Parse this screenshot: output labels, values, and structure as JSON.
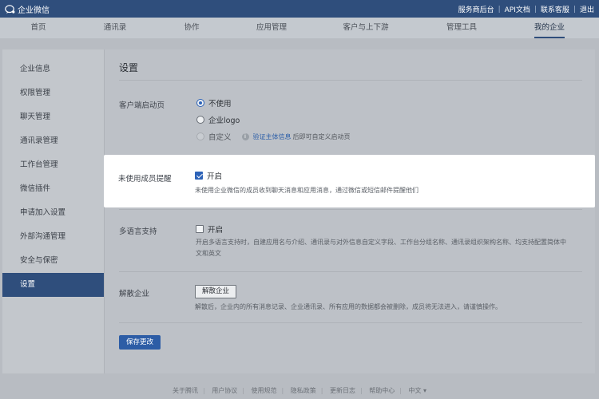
{
  "topbar": {
    "app_name": "企业微信",
    "links": [
      "服务商后台",
      "API文档",
      "联系客服",
      "退出"
    ]
  },
  "nav": {
    "tabs": [
      "首页",
      "通讯录",
      "协作",
      "应用管理",
      "客户与上下游",
      "管理工具",
      "我的企业"
    ],
    "active": "我的企业"
  },
  "sidebar": {
    "items": [
      "企业信息",
      "权限管理",
      "聊天管理",
      "通讯录管理",
      "工作台管理",
      "微信插件",
      "申请加入设置",
      "外部沟通管理",
      "安全与保密",
      "设置"
    ],
    "active": "设置"
  },
  "settings": {
    "title": "设置",
    "startup": {
      "label": "客户端启动页",
      "options": [
        "不使用",
        "企业logo",
        "自定义"
      ],
      "selected": "不使用",
      "custom_link": "验证主体信息",
      "custom_hint": "后即可自定义启动页"
    },
    "unused_reminder": {
      "label": "未使用成员提醒",
      "checkbox_label": "开启",
      "checked": true,
      "hint": "未使用企业微信的成员收到聊天消息和应用消息，通过微信或短信邮件提醒他们"
    },
    "multilang": {
      "label": "多语言支持",
      "checkbox_label": "开启",
      "checked": false,
      "hint_line1": "开启多语言支持时，自建应用名与介绍、通讯录与对外信息自定义字段、工作台分组名称、通讯录组织架构名称、均支持配置简体中",
      "hint_line2": "文和英文"
    },
    "dissolve": {
      "label": "解散企业",
      "button": "解散企业",
      "hint": "解散后，企业内的所有消息记录、企业通讯录、所有应用的数据都会被删除，成员将无法进入，请谨慎操作。"
    },
    "save_button": "保存更改"
  },
  "footer": {
    "links": [
      "关于腾讯",
      "用户协议",
      "使用规范",
      "隐私政策",
      "更新日志",
      "帮助中心",
      "中文 ▾"
    ]
  },
  "colors": {
    "topbar": "#2f4e7c",
    "accent": "#2d63b8",
    "link": "#2d5fa8"
  }
}
